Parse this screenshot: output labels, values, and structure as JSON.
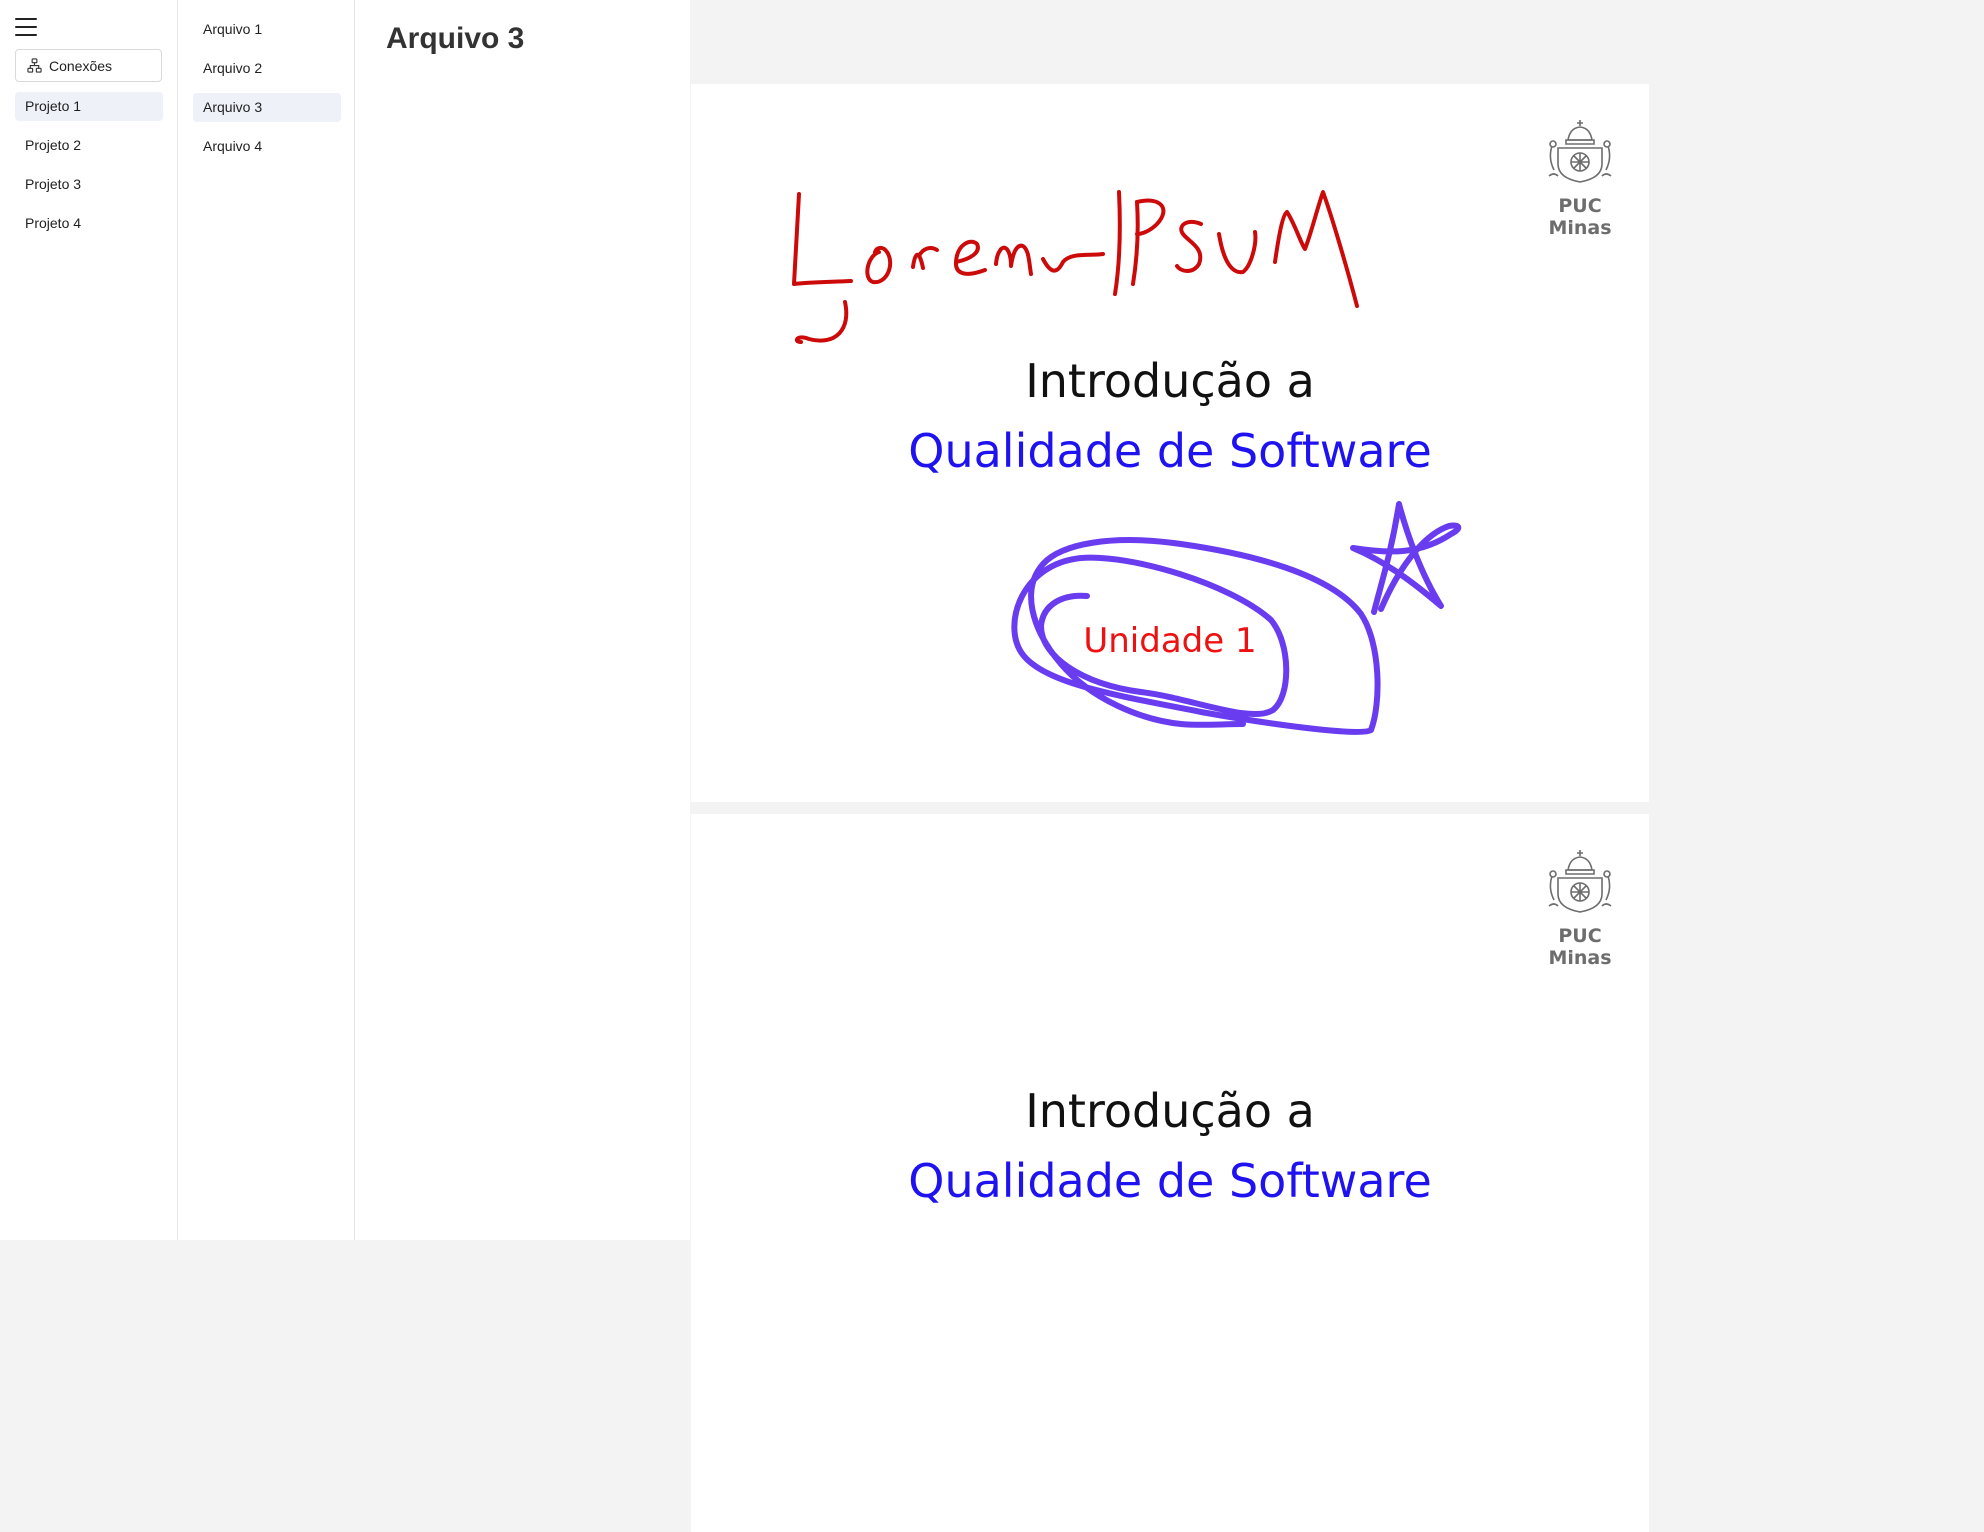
{
  "nav": {
    "connections_label": "Conexões",
    "projects": [
      {
        "label": "Projeto 1",
        "active": true
      },
      {
        "label": "Projeto 2",
        "active": false
      },
      {
        "label": "Projeto 3",
        "active": false
      },
      {
        "label": "Projeto 4",
        "active": false
      }
    ]
  },
  "files": [
    {
      "label": "Arquivo 1",
      "active": false
    },
    {
      "label": "Arquivo 2",
      "active": false
    },
    {
      "label": "Arquivo 3",
      "active": true
    },
    {
      "label": "Arquivo 4",
      "active": false
    }
  ],
  "main": {
    "title": "Arquivo 3",
    "slides": [
      {
        "logo_text": "PUC Minas",
        "title": "Introdução a",
        "subtitle": "Qualidade de Software",
        "unit": "Unidade 1"
      },
      {
        "logo_text": "PUC Minas",
        "title": "Introdução a",
        "subtitle": "Qualidade de Software"
      }
    ]
  },
  "colors": {
    "annotation_red": "#cc0a0a",
    "annotation_purple": "#6a3cf0",
    "subtitle_blue": "#1e12f0",
    "unit_red": "#ee1111",
    "active_item_bg": "#eef1f8"
  },
  "icons": [
    "menu-icon",
    "connections-icon",
    "puc-minas-crest-icon"
  ]
}
